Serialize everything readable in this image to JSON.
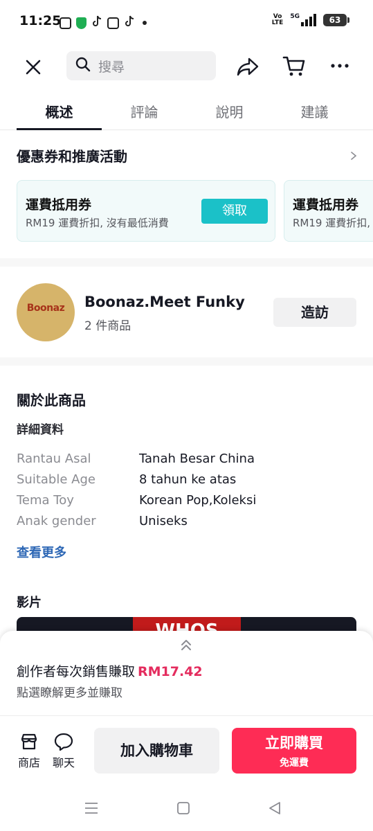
{
  "status_bar": {
    "time": "11:25",
    "network_label_top": "Vo",
    "network_label_bottom": "LTE",
    "network_5g": "5G",
    "battery": "63"
  },
  "top_nav": {
    "search_placeholder": "搜尋"
  },
  "tabs": [
    "概述",
    "評論",
    "說明",
    "建議"
  ],
  "coupons": {
    "title": "優惠券和推廣活動",
    "items": [
      {
        "name": "運費抵用券",
        "description": "RM19 運費折扣, 沒有最低消費",
        "action": "領取"
      },
      {
        "name": "運費抵用券",
        "description": "RM19 運費折扣,",
        "action": ""
      }
    ]
  },
  "shop": {
    "logo_text": "Boonaz",
    "name": "Boonaz.Meet Funky",
    "product_count": "2 件商品",
    "visit_label": "造訪"
  },
  "about": {
    "title": "關於此商品",
    "subtitle": "詳細資料",
    "specs": [
      {
        "key": "Rantau Asal",
        "value": "Tanah Besar China"
      },
      {
        "key": "Suitable Age",
        "value": "8 tahun ke atas"
      },
      {
        "key": "Tema Toy",
        "value": "Korean Pop,Koleksi"
      },
      {
        "key": "Anak gender",
        "value": "Uniseks"
      }
    ],
    "see_more": "查看更多"
  },
  "video": {
    "title": "影片",
    "thumbnail_text": "WHOS"
  },
  "creator": {
    "line1_text": "創作者每次銷售賺取",
    "amount": "RM17.42",
    "line2_text": "點選瞭解更多並賺取"
  },
  "bottom_bar": {
    "shop_label": "商店",
    "chat_label": "聊天",
    "add_to_cart": "加入購物車",
    "buy_now": "立即購買",
    "buy_now_sub": "免運費"
  },
  "colors": {
    "accent_buy": "#fe2c55",
    "coupon_button": "#1bc1c8",
    "creator_amount": "#e42c5e",
    "link": "#2d67b5"
  }
}
